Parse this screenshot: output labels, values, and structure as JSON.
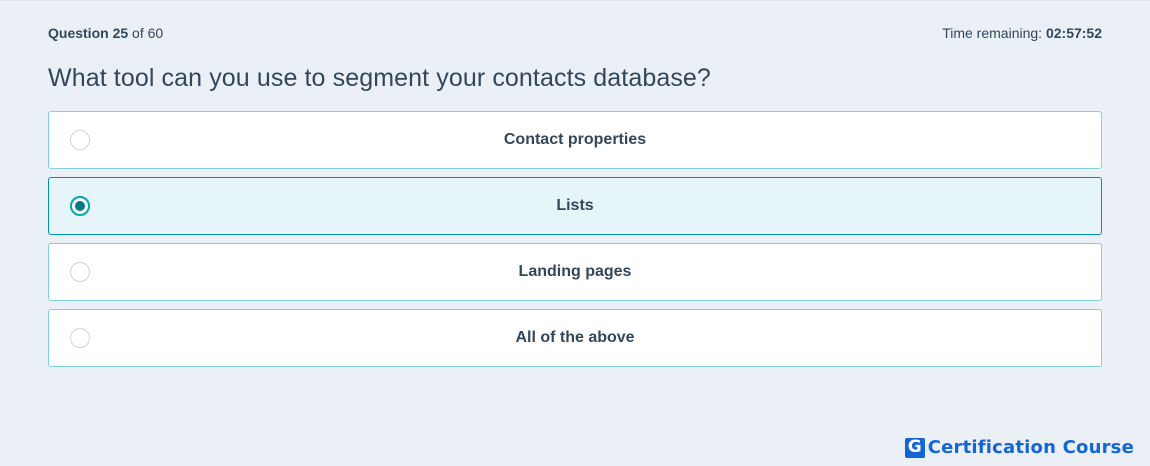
{
  "header": {
    "question_label": "Question",
    "question_number": "25",
    "question_of": "of 60",
    "time_label": "Time remaining:",
    "time_value": "02:57:52"
  },
  "question": {
    "text": "What tool can you use to segment your contacts database?"
  },
  "options": [
    {
      "label": "Contact properties",
      "selected": false
    },
    {
      "label": "Lists",
      "selected": true
    },
    {
      "label": "Landing pages",
      "selected": false
    },
    {
      "label": "All of the above",
      "selected": false
    }
  ],
  "brand": {
    "logo_letter": "G",
    "name": "Certification Course",
    "color": "#1565d8"
  },
  "colors": {
    "background": "#eaf0f6",
    "text": "#33475b",
    "option_border": "#7fd1de",
    "selected_bg": "#e5f5f8",
    "selected_border": "#0091ae",
    "radio_accent": "#00798c"
  }
}
